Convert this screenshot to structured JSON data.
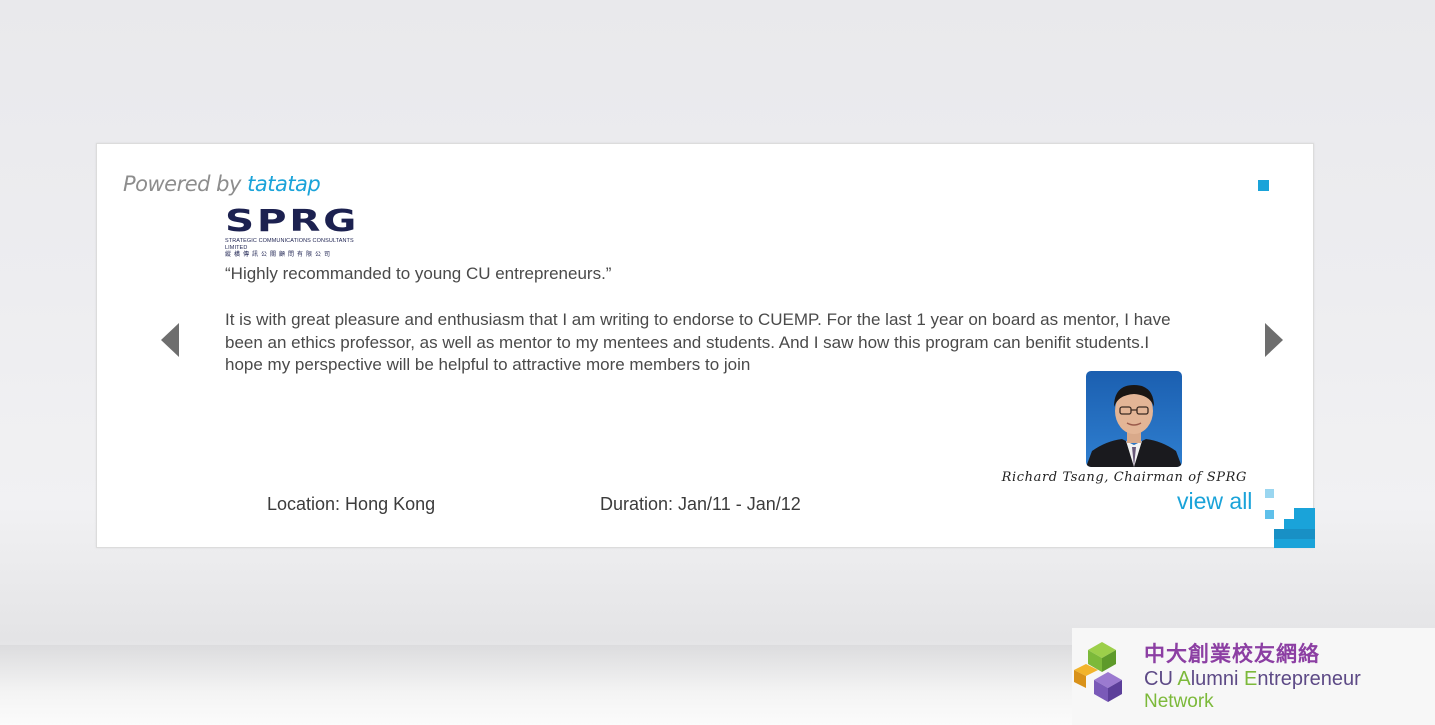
{
  "widget": {
    "powered_prefix": "Powered by ",
    "powered_brand": "tatatap",
    "logo": {
      "name": "SPRG",
      "subtitle_en": "STRATEGIC COMMUNICATIONS CONSULTANTS LIMITED",
      "subtitle_cn": "縱橫傳訊公關顧問有限公司"
    },
    "quote": "“Highly recommanded to young CU entrepreneurs.”",
    "body": "It is with great pleasure and enthusiasm that I am writing to endorse  to CUEMP. For the last 1 year on board as mentor, I have been an ethics professor, as well as mentor to my mentees and students. And I saw how this program can benifit students.I hope my perspective will be helpful to attractive more members to join",
    "signature": "Richard Tsang, Chairman of SPRG",
    "location": "Location: Hong Kong",
    "duration": "Duration: Jan/11 - Jan/12",
    "view_all": "view all"
  },
  "footer": {
    "name_cn": "中大創業校友網絡",
    "name_en_line1_c": "CU ",
    "name_en_line1_a": "A",
    "name_en_line1_lumni": "lumni ",
    "name_en_line1_e": "E",
    "name_en_line1_rest": "ntrepreneur",
    "name_en_line2": "Network"
  },
  "colors": {
    "accent": "#1aa3d9",
    "footer_purple": "#8c3fa3",
    "footer_green": "#7cb93a"
  }
}
